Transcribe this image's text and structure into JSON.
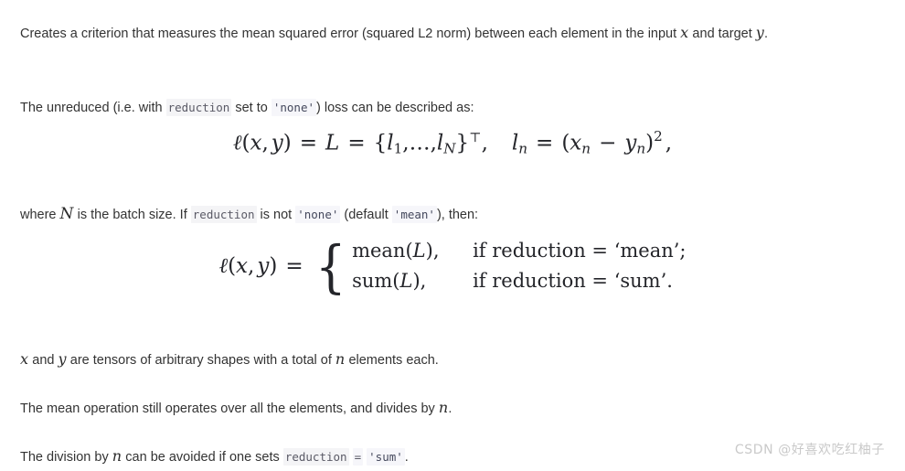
{
  "document": {
    "kind": "api-docstring",
    "background_color": "#ffffff",
    "text_color": "#333333",
    "code_background_color": "#f4f4f6",
    "code_text_color": "#5a5a66"
  },
  "paragraphs": {
    "intro": {
      "part1": "Creates a criterion that measures the mean squared error (squared L2 norm) between each element in the input ",
      "math_x": "x",
      "part2": " and target ",
      "math_y": "y",
      "part3": "."
    },
    "unreduced": {
      "part1": "The unreduced (i.e. with ",
      "code_reduction": "reduction",
      "part2": " set to ",
      "code_none": "'none'",
      "part3": ") loss can be described as:"
    },
    "where": {
      "part1": "where ",
      "math_N": "N",
      "part2": " is the batch size. If ",
      "code_reduction": "reduction",
      "part3": " is not ",
      "code_none": "'none'",
      "part4": " (default ",
      "code_mean": "'mean'",
      "part5": "), then:"
    },
    "tensors": {
      "math_x": "x",
      "part1": " and ",
      "math_y": "y",
      "part2": " are tensors of arbitrary shapes with a total of ",
      "math_n": "n",
      "part3": " elements each."
    },
    "mean_op": {
      "part1": "The mean operation still operates over all the elements, and divides by ",
      "math_n": "n",
      "part2": "."
    },
    "division": {
      "part1": "The division by ",
      "math_n": "n",
      "part2": " can be avoided if one sets ",
      "code_reduction": "reduction",
      "code_equals": "=",
      "code_sum": "'sum'",
      "part3": "."
    }
  },
  "equations": {
    "unreduced_loss": {
      "latex": "\\ell(x, y) = L = \\{l_1, \\ldots, l_N\\}^\\top, \\quad l_n = (x_n - y_n)^2,",
      "lhs_ell": "ℓ",
      "lhs_open": "(",
      "lhs_x": "x",
      "lhs_comma": ",",
      "lhs_y": "y",
      "lhs_close": ")",
      "eq1": "=",
      "L": "L",
      "eq2": "=",
      "brace_open": "{",
      "l": "l",
      "sub_1": "1",
      "ellipsis": ",…,",
      "l2": "l",
      "sub_N": "N",
      "brace_close": "}",
      "transpose": "⊤",
      "comma": ",",
      "ln_l": "l",
      "ln_sub": "n",
      "eq3": "=",
      "open_paren": "(",
      "x": "x",
      "x_sub": "n",
      "minus": "−",
      "y": "y",
      "y_sub": "n",
      "close_paren": ")",
      "power": "2",
      "trailing_comma": ","
    },
    "cases_loss": {
      "latex": "\\ell(x, y) = \\begin{cases} \\mathrm{mean}(L), & \\text{if reduction} = \\text{`mean';} \\\\ \\mathrm{sum}(L), & \\text{if reduction} = \\text{`sum'.} \\end{cases}",
      "lhs_ell": "ℓ",
      "lhs_open": "(",
      "lhs_x": "x",
      "lhs_comma": ",",
      "lhs_y": "y",
      "lhs_close": ")",
      "equals": "=",
      "brace": "{",
      "rows": [
        {
          "fn": "mean",
          "open": "(",
          "arg": "L",
          "close": ")",
          "comma": ",",
          "condition": "if reduction = ‘mean’;"
        },
        {
          "fn": "sum",
          "open": "(",
          "arg": "L",
          "close": ")",
          "comma": ",",
          "condition": "if reduction = ‘sum’."
        }
      ]
    }
  },
  "watermark": {
    "text": "CSDN @好喜欢吃红柚子",
    "color": "#c9c9c9"
  }
}
